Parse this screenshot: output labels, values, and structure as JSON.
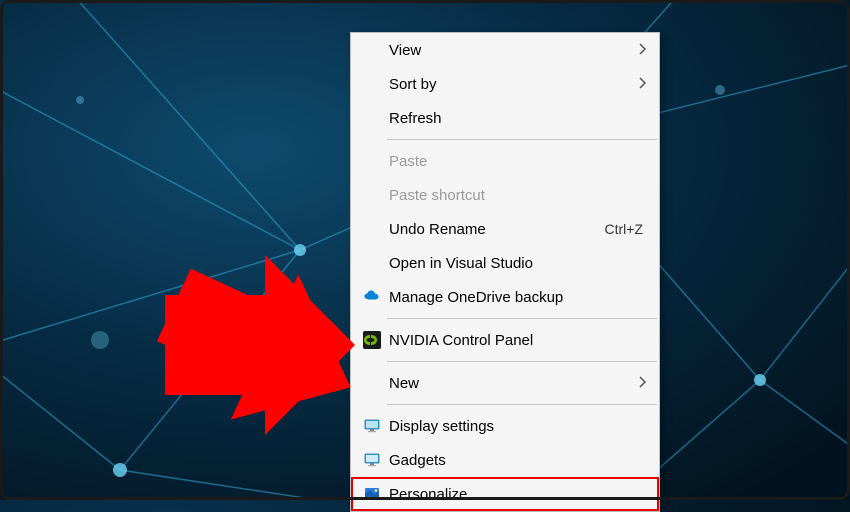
{
  "context_menu": {
    "groups": [
      {
        "items": [
          {
            "id": "view",
            "label": "View",
            "has_submenu": true,
            "enabled": true,
            "icon": null
          },
          {
            "id": "sortby",
            "label": "Sort by",
            "has_submenu": true,
            "enabled": true,
            "icon": null
          },
          {
            "id": "refresh",
            "label": "Refresh",
            "has_submenu": false,
            "enabled": true,
            "icon": null
          }
        ]
      },
      {
        "items": [
          {
            "id": "paste",
            "label": "Paste",
            "has_submenu": false,
            "enabled": false,
            "icon": null
          },
          {
            "id": "paste-shortcut",
            "label": "Paste shortcut",
            "has_submenu": false,
            "enabled": false,
            "icon": null
          },
          {
            "id": "undo-rename",
            "label": "Undo Rename",
            "shortcut": "Ctrl+Z",
            "has_submenu": false,
            "enabled": true,
            "icon": null
          },
          {
            "id": "open-vs",
            "label": "Open in Visual Studio",
            "has_submenu": false,
            "enabled": true,
            "icon": null
          },
          {
            "id": "onedrive",
            "label": "Manage OneDrive backup",
            "has_submenu": false,
            "enabled": true,
            "icon": "onedrive"
          }
        ]
      },
      {
        "items": [
          {
            "id": "nvidia",
            "label": "NVIDIA Control Panel",
            "has_submenu": false,
            "enabled": true,
            "icon": "nvidia"
          }
        ]
      },
      {
        "items": [
          {
            "id": "new",
            "label": "New",
            "has_submenu": true,
            "enabled": true,
            "icon": null
          }
        ]
      },
      {
        "items": [
          {
            "id": "display-settings",
            "label": "Display settings",
            "has_submenu": false,
            "enabled": true,
            "icon": "display"
          },
          {
            "id": "gadgets",
            "label": "Gadgets",
            "has_submenu": false,
            "enabled": true,
            "icon": "gadgets"
          },
          {
            "id": "personalize",
            "label": "Personalize",
            "has_submenu": false,
            "enabled": true,
            "icon": "personalize",
            "highlighted": true
          }
        ]
      }
    ]
  },
  "annotation": {
    "arrow_color": "#ff0000",
    "highlight_color": "#e60000"
  }
}
